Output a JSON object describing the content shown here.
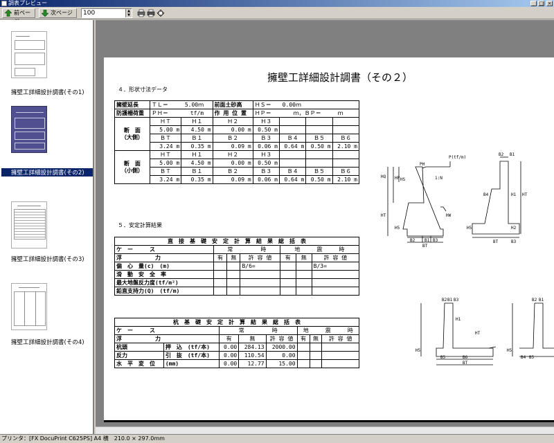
{
  "window": {
    "title": "調表プレビュー"
  },
  "toolbar": {
    "prev_label": "前ページ",
    "next_label": "次ページ",
    "zoom_value": "100"
  },
  "thumbnails": [
    {
      "label": "擁壁工詳細設計調書(その1)",
      "selected": false
    },
    {
      "label": "擁壁工詳細設計調書(その2)",
      "selected": true
    },
    {
      "label": "擁壁工詳細設計調書(その3)",
      "selected": false
    },
    {
      "label": "擁壁工詳細設計調書(その4)",
      "selected": false
    }
  ],
  "document": {
    "title": "擁壁工詳細設計調書（その２）",
    "section4": "４．形状寸法データ",
    "section5": "５．安定計算結果",
    "shape": {
      "r1": [
        "擁壁延長",
        "ＴＬ＝　　　5.00ｍ",
        "前面土砂高",
        "ＨＳ＝　　0.00ｍ"
      ],
      "r2": [
        "防護柵荷重",
        "ＰＨ＝　　　　tf/m",
        "作 用 位 置",
        "ＨＰ＝　　　　ｍ，ＢＰ＝　　　ｍ"
      ],
      "big_label": "断　面\n（大側）",
      "small_label": "断　面\n（小側）",
      "h_head": [
        "ＨＴ",
        "Ｈ１",
        "Ｈ２",
        "Ｈ３"
      ],
      "h_vals": [
        "5.00 m",
        "4.50 m",
        "0.00 m",
        "0.50 m"
      ],
      "b_head": [
        "ＢＴ",
        "Ｂ１",
        "Ｂ２",
        "Ｂ３",
        "Ｂ４",
        "Ｂ５",
        "Ｂ６"
      ],
      "b_vals": [
        "3.24 m",
        "0.35 m",
        "0.09 m",
        "0.06 m",
        "0.64 m",
        "0.50 m",
        "2.10 m"
      ]
    },
    "direct": {
      "title": "直　接　基　礎　安　定　計　算　結　果　総　括　表",
      "case_label": "ケ　ー　　　ス",
      "normal": "常　　　　　時",
      "quake": "地　　　震　　　時",
      "force": "浮　　　　　　力",
      "col_heads": [
        "有",
        "無",
        "許 容 値",
        "有",
        "無",
        "許 容 値"
      ],
      "rows": [
        {
          "label": "偏　心　量(c)　(m)",
          "vals": [
            "",
            "",
            "B/6=",
            "",
            "",
            "B/3="
          ]
        },
        {
          "label": "滑　動　安　全　率",
          "vals": [
            "",
            "",
            "",
            "",
            "",
            ""
          ]
        },
        {
          "label": "最大地盤反力度(tf/m²)",
          "vals": [
            "",
            "",
            "",
            "",
            "",
            ""
          ]
        },
        {
          "label": "鉛直支持力(Q)　(tf/m)",
          "vals": [
            "",
            "",
            "",
            "",
            "",
            ""
          ]
        }
      ]
    },
    "pile": {
      "title": "杭　基　礎　安　定　計　算　結　果　総　括　表",
      "case_label": "ケ　ー　　　ス",
      "normal": "常　　　　　時",
      "quake": "地　　　震　　　時",
      "force": "浮　　　　　　力",
      "col_heads": [
        "有",
        "無",
        "許 容 値",
        "有",
        "無",
        "許 容 値"
      ],
      "rows": [
        {
          "g": "杭頭",
          "label": "押　込　(tf/本)",
          "vals": [
            "0.00",
            "284.13",
            "2000.00",
            "",
            "",
            ""
          ]
        },
        {
          "g": "反力",
          "label": "引　抜　(tf/本)",
          "vals": [
            "0.00",
            "110.54",
            "0.00",
            "",
            "",
            ""
          ]
        },
        {
          "g": "水　平　変　位",
          "label": "(mm)",
          "vals": [
            "0.00",
            "12.77",
            "15.00",
            "",
            "",
            ""
          ]
        }
      ]
    },
    "diagram_labels": {
      "p": "P(tf/m)",
      "ph": "PH",
      "ratio": "1:N",
      "hq": "HQ",
      "hp": "HP",
      "hs": "HS",
      "ht": "HT",
      "h5": "H5",
      "hw": "HW",
      "b2": "B2",
      "b1": "B1",
      "b3": "B3",
      "bt": "BT",
      "h1": "H1",
      "h2": "H2",
      "b4": "B4",
      "b5": "B5",
      "b6": "B6"
    }
  },
  "status": {
    "text": "プリンタ：[FX DocuPrint C625PS] A4 横　210.0 × 297.0mm"
  }
}
